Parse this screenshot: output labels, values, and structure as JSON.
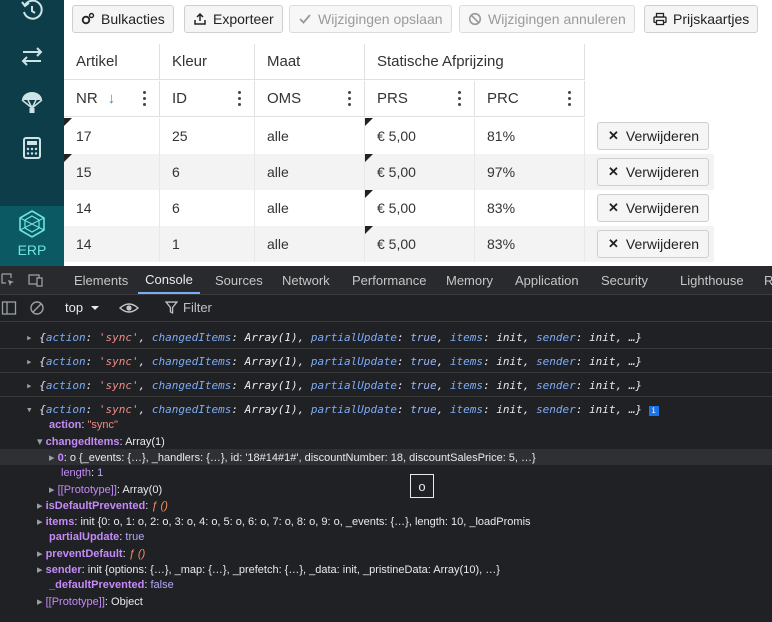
{
  "sidebar": {
    "items": [
      {
        "icon": "history-icon"
      },
      {
        "icon": "swap-icon"
      },
      {
        "icon": "parachute-icon"
      },
      {
        "icon": "calculator-icon"
      }
    ],
    "logo_label": "ERP"
  },
  "toolbar": {
    "bulk_label": "Bulkacties",
    "export_label": "Exporteer",
    "save_label": "Wijzigingen opslaan",
    "cancel_label": "Wijzigingen annuleren",
    "price_tags_label": "Prijskaartjes"
  },
  "grid": {
    "group_headers": [
      "Artikel",
      "Kleur",
      "Maat",
      "Statische Afprijzing"
    ],
    "columns": [
      "NR",
      "ID",
      "OMS",
      "PRS",
      "PRC"
    ],
    "sort_indicator": "↓",
    "delete_label": "Verwijderen",
    "rows": [
      {
        "nr": "17",
        "id": "25",
        "oms": "alle",
        "prs": "€ 5,00",
        "prc": "81%"
      },
      {
        "nr": "15",
        "id": "6",
        "oms": "alle",
        "prs": "€ 5,00",
        "prc": "97%"
      },
      {
        "nr": "14",
        "id": "6",
        "oms": "alle",
        "prs": "€ 5,00",
        "prc": "83%"
      },
      {
        "nr": "14",
        "id": "1",
        "oms": "alle",
        "prs": "€ 5,00",
        "prc": "83%"
      }
    ]
  },
  "devtools": {
    "tabs": [
      "Elements",
      "Console",
      "Sources",
      "Network",
      "Performance",
      "Memory",
      "Application",
      "Security",
      "Lighthouse",
      "R"
    ],
    "active_tab": "Console",
    "context": "top",
    "filter_placeholder": "Filter",
    "collapsed_log": "{action: 'sync', changedItems: Array(1), partialUpdate: true, items: init, sender: init, …}",
    "log_parts": {
      "open": "{",
      "action_key": "action",
      "action_val": "'sync'",
      "changed_key": "changedItems",
      "changed_val": "Array(1)",
      "partial_key": "partialUpdate",
      "partial_val": "true",
      "items_key": "items",
      "items_val": "init",
      "sender_key": "sender",
      "sender_val": "init",
      "close": "…}"
    },
    "expanded": {
      "action_key": "action",
      "action_val": "\"sync\"",
      "changed_key": "changedItems",
      "changed_val": "Array(1)",
      "item0_key": "0",
      "item0_val": "o {_events: {…}, _handlers: {…}, id: '18#14#1#', discountNumber: 18, discountSalesPrice: 5, …}",
      "length_key": "length",
      "length_val": "1",
      "proto_arr_key": "[[Prototype]]",
      "proto_arr_val": "Array(0)",
      "isdef_key": "isDefaultPrevented",
      "isdef_val": "ƒ ()",
      "items_key": "items",
      "items_val": "init {0: o, 1: o, 2: o, 3: o, 4: o, 5: o, 6: o, 7: o, 8: o, 9: o, _events: {…}, length: 10, _loadPromis",
      "partial_key": "partialUpdate",
      "partial_val": "true",
      "prevent_key": "preventDefault",
      "prevent_val": "ƒ ()",
      "sender_key": "sender",
      "sender_val": "init {options: {…}, _map: {…}, _prefetch: {…}, _data: init, _pristineData: Array(10), …}",
      "defprev_key": "_defaultPrevented",
      "defprev_val": "false",
      "proto_obj_key": "[[Prototype]]",
      "proto_obj_val": "Object"
    },
    "tooltip": "o"
  }
}
